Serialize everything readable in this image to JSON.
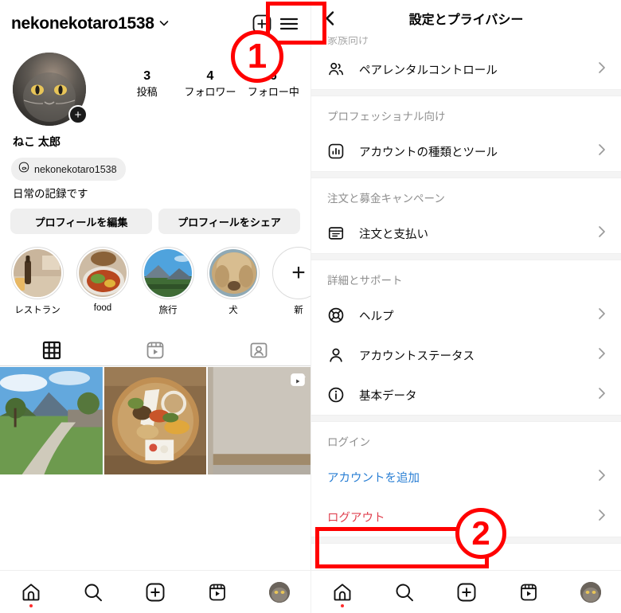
{
  "profile": {
    "username": "nekonekotaro1538",
    "chevron": "⌄",
    "stats": [
      {
        "num": "3",
        "label": "投稿"
      },
      {
        "num": "4",
        "label": "フォロワー"
      },
      {
        "num": "6",
        "label": "フォロー中"
      }
    ],
    "display_name": "ねこ 太郎",
    "threads_handle": "nekonekotaro1538",
    "bio": "日常の記録です",
    "edit_button": "プロフィールを編集",
    "share_button": "プロフィールをシェア",
    "avatar_plus": "+",
    "highlights": [
      {
        "label": "レストラン"
      },
      {
        "label": "food"
      },
      {
        "label": "旅行"
      },
      {
        "label": "犬"
      },
      {
        "label": "新"
      }
    ],
    "tabs": [
      {
        "name": "grid-tab"
      },
      {
        "name": "reels-tab"
      },
      {
        "name": "tagged-tab"
      }
    ],
    "posts": [
      {
        "alt": "garden-path-mountain"
      },
      {
        "alt": "food-plate"
      },
      {
        "alt": "room-wall",
        "is_reel": true
      }
    ]
  },
  "settings": {
    "title": "設定とプライバシー",
    "cut_off_header": "家族向け",
    "groups": [
      {
        "title": null,
        "rows": [
          {
            "icon": "people-icon",
            "label": "ペアレンタルコントロール",
            "color": "default"
          }
        ]
      },
      {
        "title": "プロフェッショナル向け",
        "rows": [
          {
            "icon": "chart-box-icon",
            "label": "アカウントの種類とツール",
            "color": "default"
          }
        ]
      },
      {
        "title": "注文と募金キャンペーン",
        "rows": [
          {
            "icon": "invoice-icon",
            "label": "注文と支払い",
            "color": "default"
          }
        ]
      },
      {
        "title": "詳細とサポート",
        "rows": [
          {
            "icon": "lifering-icon",
            "label": "ヘルプ",
            "color": "default"
          },
          {
            "icon": "person-icon",
            "label": "アカウントステータス",
            "color": "default"
          },
          {
            "icon": "info-icon",
            "label": "基本データ",
            "color": "default"
          }
        ]
      },
      {
        "title": "ログイン",
        "rows": [
          {
            "icon": null,
            "label": "アカウントを追加",
            "color": "blue"
          },
          {
            "icon": null,
            "label": "ログアウト",
            "color": "red"
          }
        ]
      }
    ],
    "chevron": "›"
  },
  "bottom_nav": {
    "items": [
      {
        "name": "home-icon",
        "active_dot": true
      },
      {
        "name": "search-icon",
        "active_dot": false
      },
      {
        "name": "create-icon",
        "active_dot": false
      },
      {
        "name": "reels-icon",
        "active_dot": false
      },
      {
        "name": "profile-avatar",
        "active_dot": false
      }
    ]
  },
  "annotations": [
    {
      "id": "1",
      "label": "1",
      "target": "hamburger-menu-button"
    },
    {
      "id": "2",
      "label": "2",
      "target": "logout-row"
    }
  ],
  "colors": {
    "accent_blue": "#2a7fd4",
    "danger_red": "#e0414f",
    "annotation_red": "#ff0000",
    "muted_gray": "#8e8e8e",
    "button_bg": "#efefef"
  }
}
